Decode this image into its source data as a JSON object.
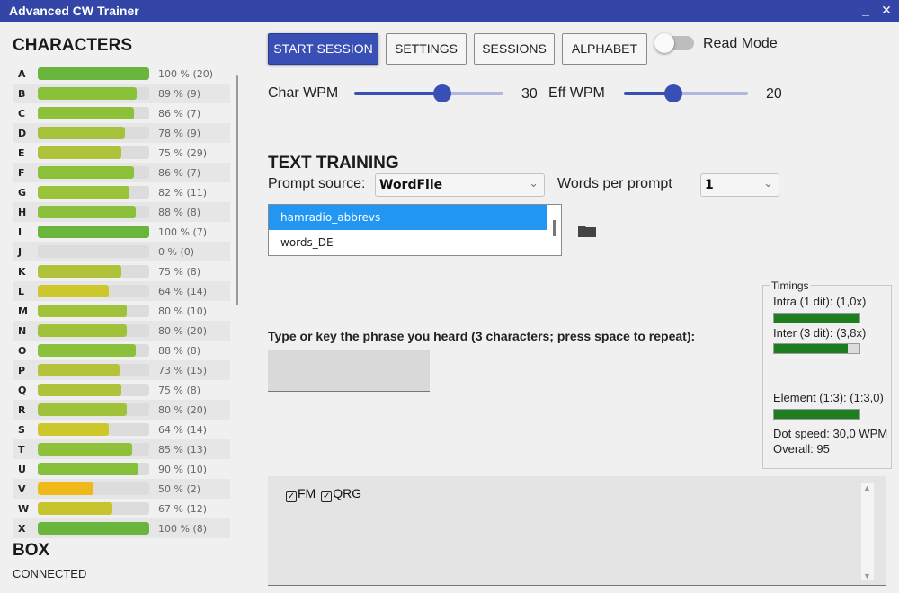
{
  "window": {
    "title": "Advanced CW Trainer",
    "minimize_icon": "minimize-icon",
    "close_icon": "close-icon"
  },
  "characters": {
    "title": "CHARACTERS",
    "rows": [
      {
        "letter": "A",
        "fraction": 1.0,
        "label": "100 % (20)",
        "color": "#6ab63c"
      },
      {
        "letter": "B",
        "fraction": 0.89,
        "label": "89 % (9)",
        "color": "#8ac03a"
      },
      {
        "letter": "C",
        "fraction": 0.86,
        "label": "86 % (7)",
        "color": "#8ec13a"
      },
      {
        "letter": "D",
        "fraction": 0.78,
        "label": "78 % (9)",
        "color": "#a6c23a"
      },
      {
        "letter": "E",
        "fraction": 0.75,
        "label": "75 % (29)",
        "color": "#b0c23a"
      },
      {
        "letter": "F",
        "fraction": 0.86,
        "label": "86 % (7)",
        "color": "#8ec13a"
      },
      {
        "letter": "G",
        "fraction": 0.82,
        "label": "82 % (11)",
        "color": "#9ac23a"
      },
      {
        "letter": "H",
        "fraction": 0.88,
        "label": "88 % (8)",
        "color": "#8bc03a"
      },
      {
        "letter": "I",
        "fraction": 1.0,
        "label": "100 % (7)",
        "color": "#6ab63c"
      },
      {
        "letter": "J",
        "fraction": 0.0,
        "label": "0 % (0)",
        "color": "#d0d0d0"
      },
      {
        "letter": "K",
        "fraction": 0.75,
        "label": "75 % (8)",
        "color": "#b0c23a"
      },
      {
        "letter": "L",
        "fraction": 0.64,
        "label": "64 % (14)",
        "color": "#ccc82c"
      },
      {
        "letter": "M",
        "fraction": 0.8,
        "label": "80 % (10)",
        "color": "#a0c23a"
      },
      {
        "letter": "N",
        "fraction": 0.8,
        "label": "80 % (20)",
        "color": "#a0c23a"
      },
      {
        "letter": "O",
        "fraction": 0.88,
        "label": "88 % (8)",
        "color": "#8bc03a"
      },
      {
        "letter": "P",
        "fraction": 0.73,
        "label": "73 % (15)",
        "color": "#b4c33a"
      },
      {
        "letter": "Q",
        "fraction": 0.75,
        "label": "75 % (8)",
        "color": "#b0c23a"
      },
      {
        "letter": "R",
        "fraction": 0.8,
        "label": "80 % (20)",
        "color": "#a0c23a"
      },
      {
        "letter": "S",
        "fraction": 0.64,
        "label": "64 % (14)",
        "color": "#ccc82c"
      },
      {
        "letter": "T",
        "fraction": 0.85,
        "label": "85 % (13)",
        "color": "#90c13a"
      },
      {
        "letter": "U",
        "fraction": 0.9,
        "label": "90 % (10)",
        "color": "#86bf3a"
      },
      {
        "letter": "V",
        "fraction": 0.5,
        "label": "50 % (2)",
        "color": "#f0b91a"
      },
      {
        "letter": "W",
        "fraction": 0.67,
        "label": "67 % (12)",
        "color": "#c6c52e"
      },
      {
        "letter": "X",
        "fraction": 1.0,
        "label": "100 % (8)",
        "color": "#6ab63c"
      }
    ]
  },
  "box": {
    "title": "BOX",
    "status": "CONNECTED"
  },
  "toolbar": {
    "start_label": "START SESSION",
    "settings_label": "SETTINGS",
    "sessions_label": "SESSIONS",
    "alphabet_label": "ALPHABET",
    "read_mode_label": "Read Mode",
    "read_mode_on": false
  },
  "speed": {
    "char_wpm_label": "Char WPM",
    "char_wpm_value": "30",
    "char_wpm_fraction": 0.59,
    "eff_wpm_label": "Eff WPM",
    "eff_wpm_value": "20",
    "eff_wpm_fraction": 0.4
  },
  "training": {
    "title": "TEXT TRAINING",
    "prompt_source_label": "Prompt source:",
    "prompt_source_value": "WordFile",
    "words_per_prompt_label": "Words per prompt",
    "words_per_prompt_value": "1",
    "files": [
      "hamradio_abbrevs",
      "words_DE"
    ],
    "selected_file_index": 0,
    "folder_icon": "folder-icon"
  },
  "timings": {
    "legend": "Timings",
    "intra_label": "Intra (1 dit): (1,0x)",
    "intra_fraction": 1.0,
    "inter_label": "Inter (3 dit):  (3,8x)",
    "inter_fraction": 0.86,
    "element_label": "Element (1:3): (1:3,0)",
    "element_fraction": 1.0,
    "dot_speed": "Dot speed: 30,0 WPM",
    "overall": "Overall: 95"
  },
  "prompt": {
    "instruction": "Type or key the phrase you heard (3 characters; press space to repeat):",
    "answer_value": ""
  },
  "results": {
    "words": [
      {
        "text": "FM",
        "checked": true
      },
      {
        "text": "QRG",
        "checked": true
      }
    ]
  },
  "colors": {
    "accent": "#3a4fb5",
    "titlebar": "#3346a8",
    "selection": "#2196f3",
    "timing_bar": "#1e7d1e"
  }
}
